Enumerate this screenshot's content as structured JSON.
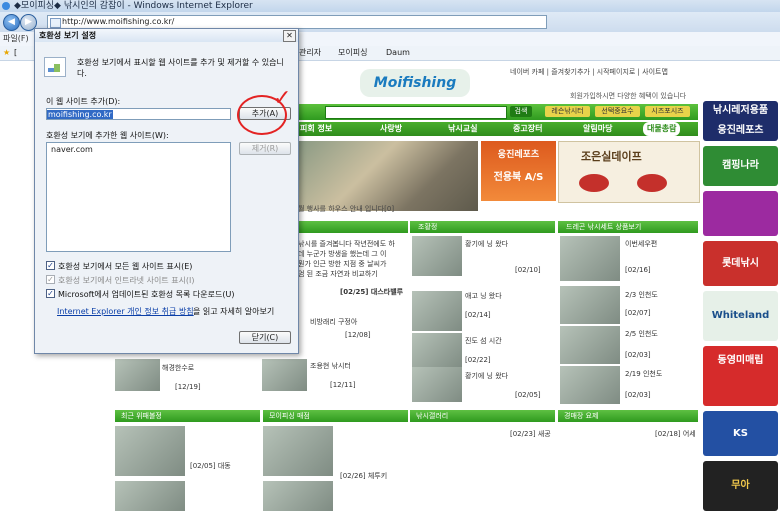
{
  "window": {
    "title": "◆모이피싱◆ 낚시인의 감잡이 - Windows Internet Explorer",
    "url": "http://www.moifishing.co.kr/",
    "menu_file": "파일(F)",
    "links_label": "[",
    "fav_items": [
      "관리자",
      "모이피싱",
      "Daum"
    ]
  },
  "dialog": {
    "title": "호환성 보기 설정",
    "description_line1": "호환성 보기에서 표시할 웹 사이트를 추가 및 제거할 수 있습니",
    "description_line2": "다.",
    "add_label": "이 웹 사이트 추가(D):",
    "add_value": "moifishing.co.kr",
    "add_button": "추가(A)",
    "list_label": "호환성 보기에 추가한 웹 사이트(W):",
    "list_items": [
      "naver.com"
    ],
    "remove_button": "제거(R)",
    "check1": "호환성 보기에서 모든 웹 사이트 표시(E)",
    "check2": "호환성 보기에서 인트라넷 사이트 표시(I)",
    "check3": "Microsoft에서 업데이트된 호환성 목록 다운로드(U)",
    "link_text": "Internet Explorer 개인 정보 취급 방침",
    "link_suffix": "을 읽고 자세히 알아보기",
    "close_button": "닫기(C)",
    "check_states": {
      "check1": true,
      "check2": true,
      "check3": true
    }
  },
  "site": {
    "logo": "Moifishing",
    "topnav": "네이버 카페 | 즐겨찾기추가 | 시작페이지로 | 사이트맵",
    "top_sub": "회원가입하시면 다양한 혜택이 있습니다",
    "search_btn": "검색",
    "quick_btns": [
      "레슨낚시터",
      "선택중요수",
      "시즈포시즈"
    ],
    "nav": [
      "피회 정보",
      "사랑방",
      "낚시교실",
      "중고장터",
      "알림마당",
      "대물총람"
    ],
    "ad_title": "웅진레포츠",
    "ad_sub": "전용북 A/S",
    "ad_right": "조은실데이프",
    "notice": "월 행사를 하우스 안내 입니다[0]",
    "col_headers": [
      "조황정",
      "조황정",
      "드레곤 낚시세트 상품보기"
    ],
    "col1_text": [
      "낚시를 즐겨봅니다 작년전에도 하",
      "데 누군가 방생을 했는데 그 이",
      "뭔가 인근 방한 지점 중 날씨가",
      "엄 된 조금 자연과 비교하기"
    ],
    "col1_footer": "[02/25] 대스타밸루",
    "col1_rows": [
      [
        "비방래리 구정아",
        "[12/08]"
      ],
      [
        "조용현 낚시터",
        "[12/11]"
      ],
      [
        "해경한수로",
        "[12/19]"
      ]
    ],
    "col2_rows": [
      [
        "황기에 닝 왔다",
        "[02/10]"
      ],
      [
        "애고 닝 왔다",
        "[02/14]"
      ],
      [
        "진도 섬 시간",
        "[02/22]"
      ],
      [
        "황기에 닝 왔다",
        "[02/05]"
      ]
    ],
    "col3_rows": [
      [
        "이번세우편",
        "[02/16]"
      ],
      [
        "2/3 인천도",
        "[02/07]"
      ],
      [
        "2/5 인천도",
        "[02/03]"
      ],
      [
        "2/19 인천도",
        "[02/03]"
      ]
    ],
    "bottom_headers": [
      "최근 위패볼정",
      "모이피싱 매점",
      "낚시갤러리",
      "경매장 요제"
    ],
    "bottom_rows": [
      [
        "[02/05] 대동"
      ],
      [
        "[02/26] 체투키"
      ],
      [
        "[02/23] 새공"
      ],
      [
        "[02/18] 어세"
      ]
    ],
    "side_ads": [
      "낚시레저용품",
      "웅진레포츠",
      "캠핑나라",
      "롯데낚시",
      "Whiteland",
      "동영미매립",
      "KS",
      "무아"
    ]
  }
}
